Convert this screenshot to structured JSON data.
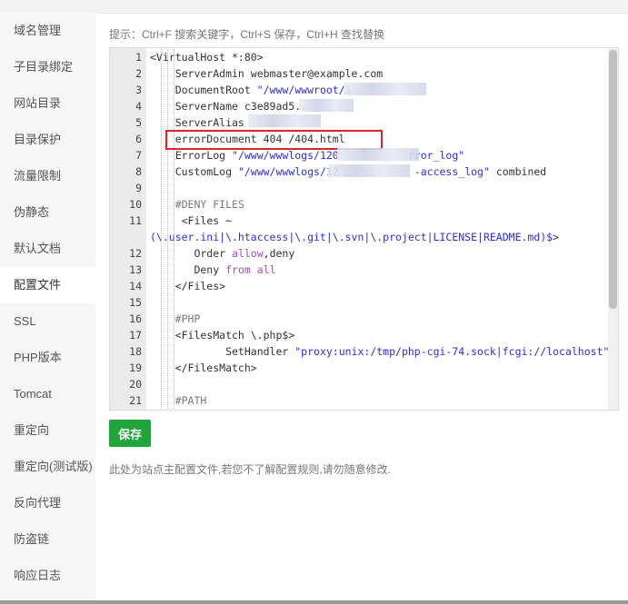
{
  "sidebar": {
    "items": [
      {
        "label": "域名管理"
      },
      {
        "label": "子目录绑定"
      },
      {
        "label": "网站目录"
      },
      {
        "label": "目录保护"
      },
      {
        "label": "流量限制"
      },
      {
        "label": "伪静态"
      },
      {
        "label": "默认文档"
      },
      {
        "label": "配置文件",
        "active": true
      },
      {
        "label": "SSL"
      },
      {
        "label": "PHP版本"
      },
      {
        "label": "Tomcat"
      },
      {
        "label": "重定向"
      },
      {
        "label": "重定向(测试版)"
      },
      {
        "label": "反向代理"
      },
      {
        "label": "防盗链"
      },
      {
        "label": "响应日志"
      }
    ]
  },
  "tip": "提示：Ctrl+F 搜索关键字，Ctrl+S 保存，Ctrl+H 查找替换",
  "editor": {
    "lines": [
      {
        "n": "1",
        "parts": [
          [
            "",
            "<VirtualHost *:80>"
          ]
        ]
      },
      {
        "n": "2",
        "parts": [
          [
            "",
            "    ServerAdmin webmaster@example.com"
          ]
        ]
      },
      {
        "n": "3",
        "parts": [
          [
            "",
            "    DocumentRoot "
          ],
          [
            "str",
            "\"/www/wwwroot/1"
          ]
        ]
      },
      {
        "n": "4",
        "parts": [
          [
            "",
            "    ServerName c3e89ad5.."
          ]
        ]
      },
      {
        "n": "5",
        "parts": [
          [
            "",
            "    ServerAlias"
          ]
        ]
      },
      {
        "n": "6",
        "parts": [
          [
            "",
            "    errorDocument 404 /404.html"
          ]
        ]
      },
      {
        "n": "7",
        "parts": [
          [
            "",
            "    ErrorLog "
          ],
          [
            "str",
            "\"/www/wwwlogs/120"
          ],
          [
            "",
            "           "
          ],
          [
            "str",
            "rror_log\""
          ]
        ]
      },
      {
        "n": "8",
        "parts": [
          [
            "",
            "    CustomLog "
          ],
          [
            "str",
            "\"/www/wwwlogs/12"
          ],
          [
            "",
            "            "
          ],
          [
            "str",
            "-access_log\""
          ],
          [
            "",
            " combined"
          ]
        ]
      },
      {
        "n": "9",
        "parts": [
          [
            "",
            ""
          ]
        ]
      },
      {
        "n": "10",
        "parts": [
          [
            "",
            "    "
          ],
          [
            "cm",
            "#DENY FILES"
          ]
        ]
      },
      {
        "n": "11",
        "wrap": true,
        "parts": [
          [
            "",
            "     <Files ~ "
          ],
          [
            "str",
            "(\\.user.ini|\\.htaccess|\\.git|\\.svn|\\.project|LICENSE|README.md)$"
          ],
          [
            "",
            ">"
          ]
        ]
      },
      {
        "n": "12",
        "parts": [
          [
            "",
            "       Order "
          ],
          [
            "kw",
            "allow"
          ],
          [
            "",
            ",deny"
          ]
        ]
      },
      {
        "n": "13",
        "parts": [
          [
            "",
            "       Deny "
          ],
          [
            "kw",
            "from"
          ],
          [
            "",
            " "
          ],
          [
            "kw",
            "all"
          ]
        ]
      },
      {
        "n": "14",
        "parts": [
          [
            "",
            "    </Files>"
          ]
        ]
      },
      {
        "n": "15",
        "parts": [
          [
            "",
            ""
          ]
        ]
      },
      {
        "n": "16",
        "parts": [
          [
            "",
            "    "
          ],
          [
            "cm",
            "#PHP"
          ]
        ]
      },
      {
        "n": "17",
        "parts": [
          [
            "",
            "    <FilesMatch \\.php$>"
          ]
        ]
      },
      {
        "n": "18",
        "parts": [
          [
            "",
            "            SetHandler "
          ],
          [
            "str",
            "\"proxy:unix:/tmp/php-cgi-74.sock|fcgi://localhost\""
          ]
        ]
      },
      {
        "n": "19",
        "parts": [
          [
            "",
            "    </FilesMatch>"
          ]
        ]
      },
      {
        "n": "20",
        "parts": [
          [
            "",
            ""
          ]
        ]
      },
      {
        "n": "21",
        "parts": [
          [
            "",
            "    "
          ],
          [
            "cm",
            "#PATH"
          ]
        ]
      }
    ]
  },
  "save_label": "保存",
  "note": "此处为站点主配置文件,若您不了解配置规则,请勿随意修改.",
  "colors": {
    "accent": "#20a53a",
    "highlight": "#d9272e",
    "string": "#2e2edc",
    "keyword": "#a24dbd"
  }
}
